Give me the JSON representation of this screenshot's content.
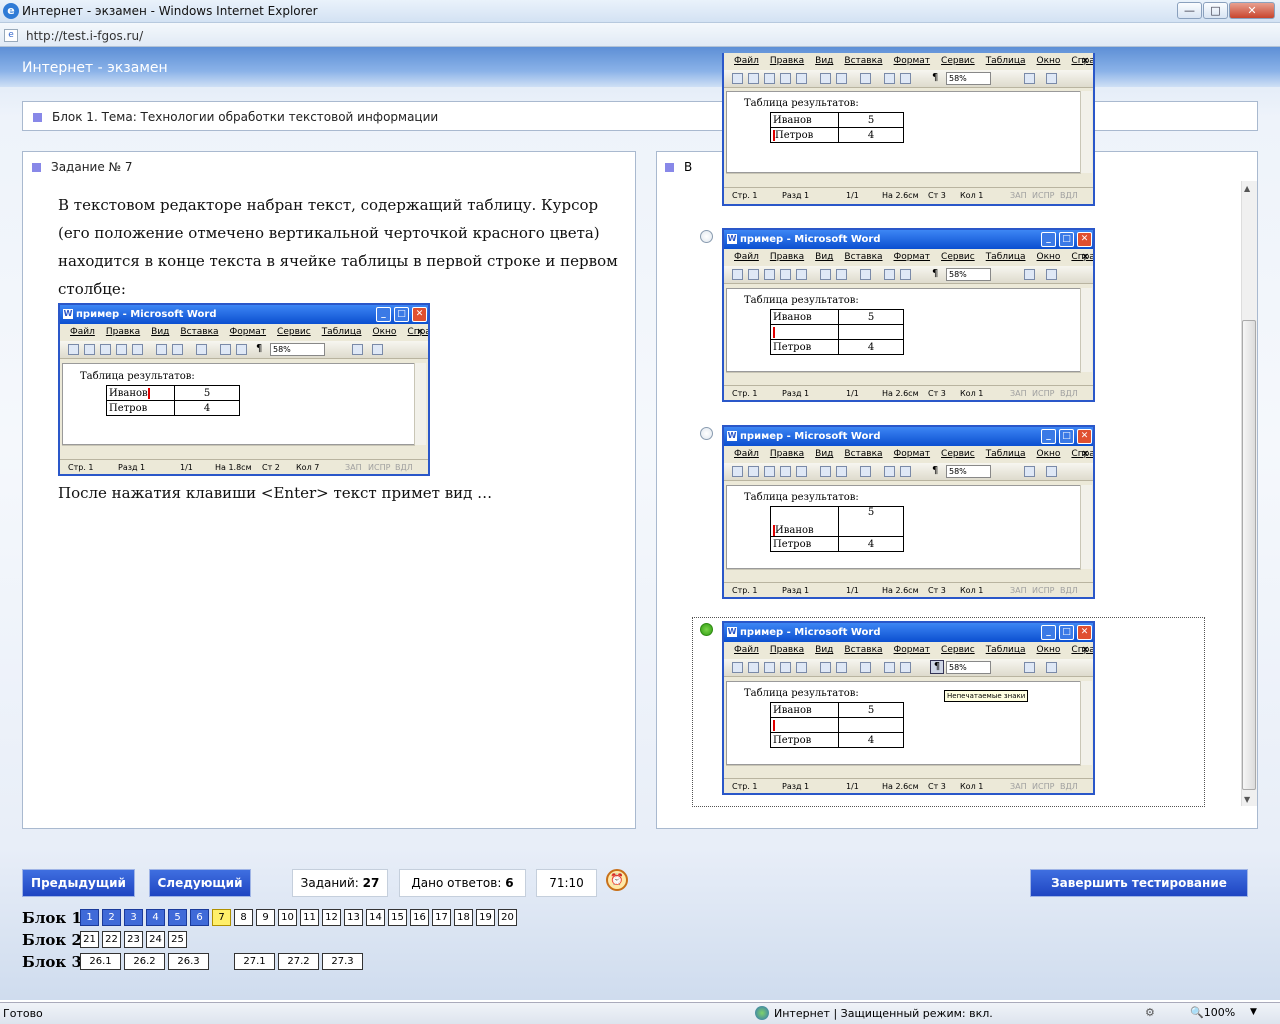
{
  "window": {
    "title": "Интернет - экзамен - Windows Internet Explorer",
    "min": "—",
    "max": "□",
    "close": "✕"
  },
  "address": {
    "url": "http://test.i-fgos.ru/"
  },
  "header": {
    "title": "Интернет - экзамен"
  },
  "block_title": "Блок 1. Тема: Технологии обработки текстовой информации",
  "task": {
    "title": "Задание № 7",
    "question": "В текстовом редакторе набран текст, содержащий таблицу. Курсор (его положение отмечено вертикальной черточкой красного цвета) находится в конце текста в ячейке таблицы в первой строке и первом столбце:",
    "after": "После нажатия клавиши <Enter> текст примет вид …"
  },
  "right_header": "В",
  "word": {
    "title": "пример - Microsoft Word",
    "menu": [
      "Файл",
      "Правка",
      "Вид",
      "Вставка",
      "Формат",
      "Сервис",
      "Таблица",
      "Окно",
      "Справка"
    ],
    "zoom": "58%",
    "doc_heading": "Таблица результатов:",
    "row1_name": "Иванов",
    "row1_val": "5",
    "row2_name": "Петров",
    "row2_val": "4",
    "tooltip": "Непечатаемые знаки"
  },
  "status_q": {
    "page": "Стр. 1",
    "section": "Разд 1",
    "pages": "1/1",
    "at": "На 1.8см",
    "line": "Ст 2",
    "col": "Кол 7",
    "zap": "ЗАП",
    "ispr": "ИСПР",
    "vdl": "ВДЛ"
  },
  "status_a": {
    "page": "Стр. 1",
    "section": "Разд 1",
    "pages": "1/1",
    "at": "На 2.6см",
    "line": "Ст 3",
    "col": "Кол 1",
    "zap": "ЗАП",
    "ispr": "ИСПР",
    "vdl": "ВДЛ"
  },
  "nav": {
    "prev": "Предыдущий",
    "next": "Следующий",
    "tasks_label": "Заданий:",
    "tasks_count": "27",
    "answers_label": "Дано ответов:",
    "answers_count": "6",
    "timer": "71:10",
    "finish": "Завершить тестирование"
  },
  "blocks": [
    {
      "label": "Блок 1",
      "items": [
        "1",
        "2",
        "3",
        "4",
        "5",
        "6",
        "7",
        "8",
        "9",
        "10",
        "11",
        "12",
        "13",
        "14",
        "15",
        "16",
        "17",
        "18",
        "19",
        "20"
      ]
    },
    {
      "label": "Блок 2",
      "items": [
        "21",
        "22",
        "23",
        "24",
        "25"
      ]
    },
    {
      "label": "Блок 3",
      "items": [
        "26.1",
        "26.2",
        "26.3",
        "27.1",
        "27.2",
        "27.3"
      ]
    }
  ],
  "statusbar": {
    "left": "Готово",
    "zone": "Интернет | Защищенный режим: вкл.",
    "zoom": "100%"
  }
}
